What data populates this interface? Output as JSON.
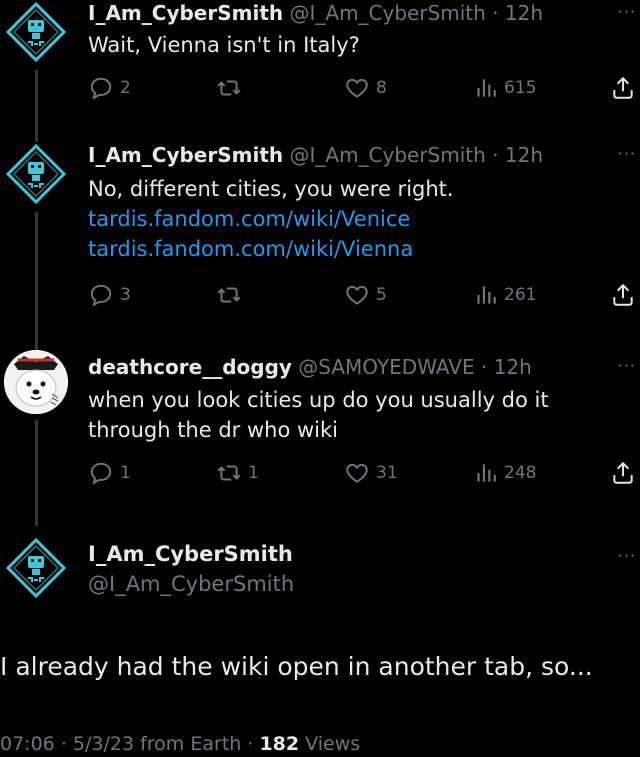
{
  "tweets": [
    {
      "name": "I_Am_CyberSmith",
      "handle": "@I_Am_CyberSmith",
      "sep": "·",
      "time": "12h",
      "more": "···",
      "text": "Wait, Vienna isn't in Italy?",
      "links": [],
      "replies": "2",
      "retweets": "",
      "likes": "8",
      "views": "615"
    },
    {
      "name": "I_Am_CyberSmith",
      "handle": "@I_Am_CyberSmith",
      "sep": "·",
      "time": "12h",
      "more": "···",
      "text": "No, different cities, you were right.",
      "links": [
        "tardis.fandom.com/wiki/Venice",
        "tardis.fandom.com/wiki/Vienna"
      ],
      "replies": "3",
      "retweets": "",
      "likes": "5",
      "views": "261"
    },
    {
      "name": "deathcore__doggy",
      "handle": "@SAMOYEDWAVE",
      "sep": "·",
      "time": "12h",
      "more": "···",
      "text_line1": "when you look cities up do you usually do it",
      "text_line2": "through the dr who wiki",
      "replies": "1",
      "retweets": "1",
      "likes": "31",
      "views": "248"
    }
  ],
  "focus": {
    "name": "I_Am_CyberSmith",
    "handle": "@I_Am_CyberSmith",
    "more": "···",
    "text": "I already had the wiki open in another tab, so...",
    "time": "07:06",
    "sep": "·",
    "date": "5/3/23 from Earth",
    "views_count": "182",
    "views_label": "Views"
  },
  "colors": {
    "accent": "#1d9bf0",
    "muted": "#71767b",
    "avatar_cyan": "#3ec7d6"
  },
  "icons": [
    "reply-icon",
    "retweet-icon",
    "like-icon",
    "views-icon",
    "share-icon"
  ]
}
